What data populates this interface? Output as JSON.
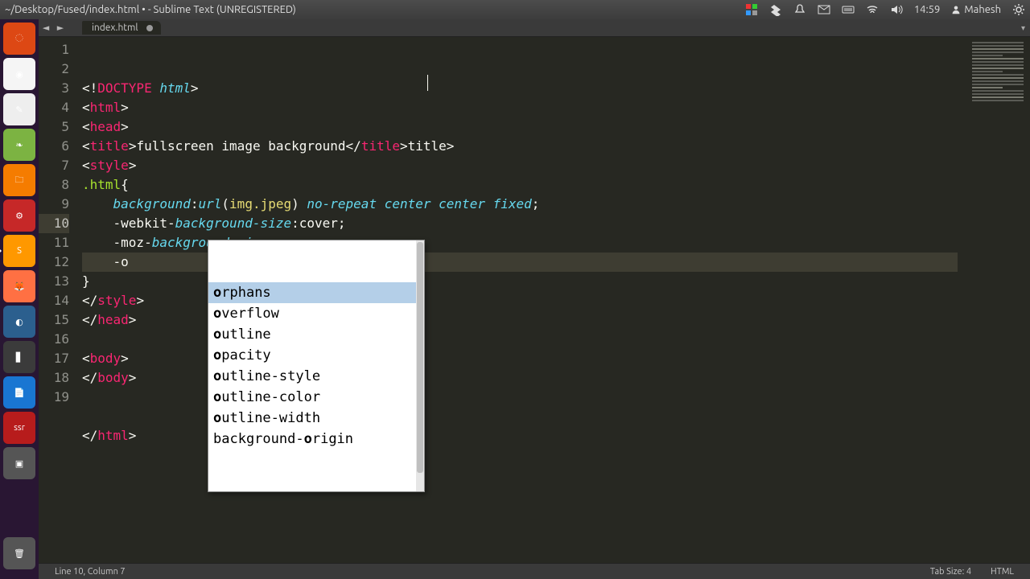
{
  "panel": {
    "window_title": "~/Desktop/Fused/index.html • - Sublime Text (UNREGISTERED)",
    "time": "14:59",
    "username": "Mahesh"
  },
  "tab": {
    "filename": "index.html",
    "dirty": true
  },
  "gutter": {
    "start": 1,
    "end": 19,
    "current": 10
  },
  "code_lines": [
    {
      "n": 1,
      "html": "<span class='br'>&lt;!</span><span class='tag'>DOCTYPE</span><span class='p'> </span><span class='kw'>html</span><span class='br'>&gt;</span>"
    },
    {
      "n": 2,
      "html": "<span class='br'>&lt;</span><span class='tag'>html</span><span class='br'>&gt;</span>"
    },
    {
      "n": 3,
      "html": "<span class='br'>&lt;</span><span class='tag'>head</span><span class='br'>&gt;</span>"
    },
    {
      "n": 4,
      "html": "<span class='br'>&lt;</span><span class='tag'>title</span><span class='br'>&gt;</span><span class='p'>fullscreen image background</span><span class='br'>&lt;/</span><span class='tag'>title</span><span class='br'>&gt;</span><span class='p'>title&gt;</span>"
    },
    {
      "n": 5,
      "html": "<span class='br'>&lt;</span><span class='tag'>style</span><span class='br'>&gt;</span>"
    },
    {
      "n": 6,
      "html": "<span class='sel'>.html</span><span class='p'>{</span>"
    },
    {
      "n": 7,
      "html": "    <span class='prop'>background</span><span class='p'>:</span><span class='kw2'>url</span><span class='p'>(</span><span class='str'>img.jpeg</span><span class='p'>) </span><span class='kw2'>no-repeat</span><span class='p'> </span><span class='kw2'>center</span><span class='p'> </span><span class='kw2'>center</span><span class='p'> </span><span class='kw2'>fixed</span><span class='p'>;</span>"
    },
    {
      "n": 8,
      "html": "    <span class='p'>-webkit-</span><span class='prop'>background-size</span><span class='p'>:cover;</span>"
    },
    {
      "n": 9,
      "html": "    <span class='p'>-moz-</span><span class='prop'>background-size</span><span class='p'>:cover;</span>"
    },
    {
      "n": 10,
      "html": "    <span class='p'>-o</span>"
    },
    {
      "n": 11,
      "html": "<span class='p'>}</span>"
    },
    {
      "n": 12,
      "html": "<span class='br'>&lt;/</span><span class='tag'>style</span><span class='br'>&gt;</span>"
    },
    {
      "n": 13,
      "html": "<span class='br'>&lt;/</span><span class='tag'>head</span><span class='br'>&gt;</span>"
    },
    {
      "n": 14,
      "html": ""
    },
    {
      "n": 15,
      "html": "<span class='br'>&lt;</span><span class='tag'>body</span><span class='br'>&gt;</span>"
    },
    {
      "n": 16,
      "html": "<span class='br'>&lt;/</span><span class='tag'>body</span><span class='br'>&gt;</span>"
    },
    {
      "n": 17,
      "html": ""
    },
    {
      "n": 18,
      "html": ""
    },
    {
      "n": 19,
      "html": "<span class='br'>&lt;/</span><span class='tag'>html</span><span class='br'>&gt;</span>"
    }
  ],
  "autocomplete": {
    "selected_index": 0,
    "items": [
      {
        "pre": "o",
        "rest": "rphans"
      },
      {
        "pre": "o",
        "rest": "verflow"
      },
      {
        "pre": "o",
        "rest": "utline"
      },
      {
        "pre": "o",
        "rest": "pacity"
      },
      {
        "pre": "o",
        "rest": "utline-style"
      },
      {
        "pre": "o",
        "rest": "utline-color"
      },
      {
        "pre": "o",
        "rest": "utline-width"
      },
      {
        "pre": "background-",
        "bold": "o",
        "rest2": "rigin"
      }
    ]
  },
  "status": {
    "position": "Line 10, Column 7",
    "tab_size": "Tab Size: 4",
    "syntax": "HTML"
  },
  "launcher": [
    {
      "name": "dash",
      "bg": "#dd4814",
      "glyph": "◌"
    },
    {
      "name": "chrome",
      "bg": "#f5f5f5",
      "glyph": "◉"
    },
    {
      "name": "gedit",
      "bg": "#eeeeee",
      "glyph": "✎"
    },
    {
      "name": "midori",
      "bg": "#7cb342",
      "glyph": "❧"
    },
    {
      "name": "files",
      "bg": "#f57c00",
      "glyph": "🗀"
    },
    {
      "name": "software",
      "bg": "#c62828",
      "glyph": "⚙"
    },
    {
      "name": "sublime",
      "bg": "#ff9800",
      "glyph": "S",
      "active": true
    },
    {
      "name": "firefox",
      "bg": "#ff7043",
      "glyph": "🦊"
    },
    {
      "name": "app1",
      "bg": "#2b5f8e",
      "glyph": "◐"
    },
    {
      "name": "app2",
      "bg": "#3b3b3b",
      "glyph": "▋"
    },
    {
      "name": "libre",
      "bg": "#1976d2",
      "glyph": "📄"
    },
    {
      "name": "ssr",
      "bg": "#b71c1c",
      "glyph": "ssr"
    },
    {
      "name": "term",
      "bg": "#555",
      "glyph": "▣"
    }
  ]
}
